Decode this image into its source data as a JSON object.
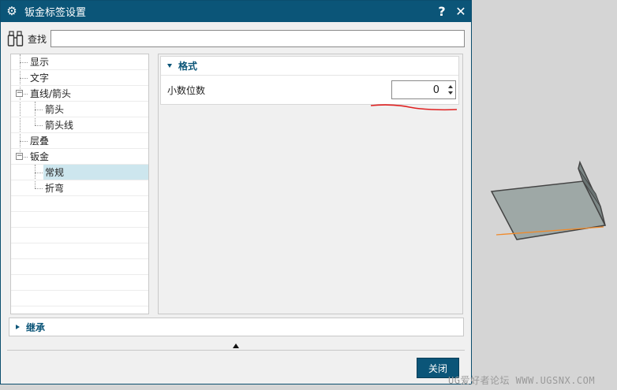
{
  "dialog": {
    "title": "钣金标签设置",
    "help_label": "?",
    "close_glyph": "✕"
  },
  "find": {
    "label": "查找",
    "value": "",
    "placeholder": ""
  },
  "tree": {
    "items": [
      {
        "label": "显示",
        "level": 0
      },
      {
        "label": "文字",
        "level": 0
      },
      {
        "label": "直线/箭头",
        "level": 0,
        "expanded": true
      },
      {
        "label": "箭头",
        "level": 1
      },
      {
        "label": "箭头线",
        "level": 1
      },
      {
        "label": "层叠",
        "level": 0
      },
      {
        "label": "钣金",
        "level": 0,
        "expanded": true
      },
      {
        "label": "常规",
        "level": 1,
        "selected": true
      },
      {
        "label": "折弯",
        "level": 1
      }
    ]
  },
  "format_section": {
    "title": "格式",
    "decimal_places_label": "小数位数",
    "decimal_places_value": "0"
  },
  "inherit_section": {
    "title": "继承"
  },
  "footer": {
    "close_label": "关闭"
  },
  "watermark": "UG爱好者论坛 WWW.UGSNX.COM",
  "colors": {
    "accent": "#0b5578",
    "selection": "#cde6ee",
    "annotation_red": "#e02020",
    "model_face": "#9ea8a6",
    "orange_line": "#f08a2a"
  }
}
